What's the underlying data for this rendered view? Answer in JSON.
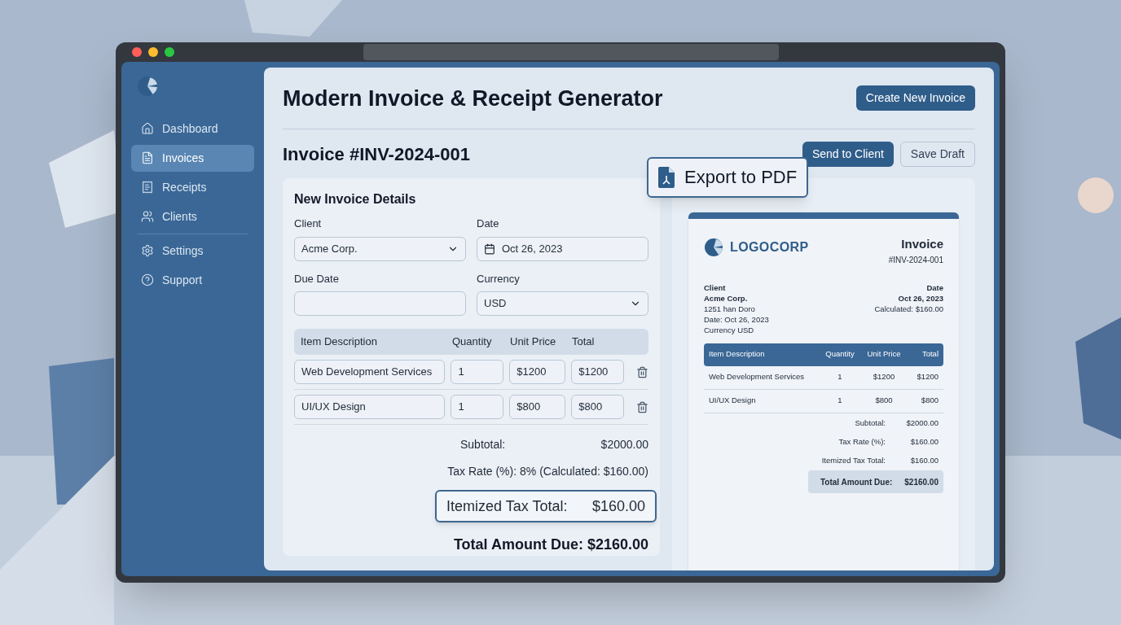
{
  "sidebar": {
    "items": [
      {
        "label": "Dashboard",
        "selected": false
      },
      {
        "label": "Invoices",
        "selected": true
      },
      {
        "label": "Receipts",
        "selected": false
      },
      {
        "label": "Clients",
        "selected": false
      }
    ],
    "secondary_items": [
      {
        "label": "Settings",
        "selected": false
      },
      {
        "label": "Support",
        "selected": false
      }
    ]
  },
  "header": {
    "title": "Modern Invoice & Receipt Generator",
    "button": "Create New Invoice"
  },
  "invoice": {
    "title": "Invoice #INV-2024-001",
    "actions": [
      "Send to Client",
      "Save Draft"
    ],
    "export_button": "Export to PDF"
  },
  "form": {
    "title": "New Invoice Details",
    "fields": [
      {
        "label": "Client",
        "value": "Acme Corp.",
        "kind": "select"
      },
      {
        "label": "Date",
        "value": "Oct 26, 2023",
        "kind": "date"
      },
      {
        "label": "Due Date",
        "kind": "text"
      },
      {
        "label": "Currency",
        "value": "USD",
        "kind": "select"
      }
    ],
    "columns": [
      "Item Description",
      "Quantity",
      "Unit Price",
      "Total"
    ],
    "rows": [
      [
        "Web Development Services",
        "1",
        "$1200",
        "$1200"
      ],
      [
        "UI/UX Design",
        "1",
        "$800",
        "$800"
      ]
    ],
    "subtotal": {
      "label": "Subtotal:",
      "value": "$2000.00"
    },
    "tax_rate": "Tax Rate (%): 8% (Calculated: $160.00)",
    "itemized_tax": {
      "label": "Itemized Tax Total:",
      "value": "$160.00"
    },
    "total": "Total Amount Due: $2160.00"
  },
  "preview": {
    "logo": "LOGOCORP",
    "title": "Invoice",
    "number": "#INV-2024-001",
    "client_heading": "Client",
    "client_lines": [
      "Acme Corp.",
      "1251 han Doro",
      "Date: Oct 26, 2023",
      "Currency USD"
    ],
    "date_heading": "Date",
    "date_lines": [
      "Oct 26, 2023",
      "Calculated: $160.00"
    ],
    "columns": [
      "Item Description",
      "Quantity",
      "Unit Price",
      "Total"
    ],
    "rows": [
      [
        "Web Development Services",
        "1",
        "$1200",
        "$1200"
      ],
      [
        "UI/UX Design",
        "1",
        "$800",
        "$800"
      ]
    ],
    "summary": [
      {
        "label": "Subtotal:",
        "value": "$2000.00"
      },
      {
        "label": "Tax Rate (%):",
        "value": "$160.00"
      },
      {
        "label": "Itemized Tax Total:",
        "value": "$160.00"
      }
    ],
    "total": {
      "label": "Total Amount Due:",
      "value": "$2160.00"
    }
  }
}
